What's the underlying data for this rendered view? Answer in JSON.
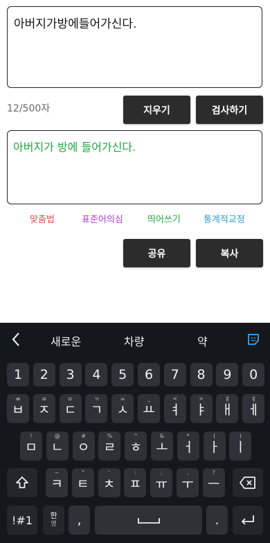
{
  "input": {
    "text": "아버지가방에들어가신다."
  },
  "counter": "12/500자",
  "buttons": {
    "clear": "지우기",
    "check": "검사하기",
    "share": "공유",
    "copy": "복사"
  },
  "output": {
    "text": "아버지가 방에 들어가신다."
  },
  "legend": [
    {
      "label": "맞춤법",
      "color": "#d9534f"
    },
    {
      "label": "표준어의심",
      "color": "#b03bd1"
    },
    {
      "label": "띄어쓰기",
      "color": "#1fa53f"
    },
    {
      "label": "통계적교정",
      "color": "#2aa0c8"
    }
  ],
  "keyboard": {
    "suggestions": [
      "새로운",
      "차량",
      "약"
    ],
    "numbers": [
      "1",
      "2",
      "3",
      "4",
      "5",
      "6",
      "7",
      "8",
      "9",
      "0"
    ],
    "row1": [
      {
        "k": "ㅂ",
        "h": "ㅃ"
      },
      {
        "k": "ㅈ",
        "h": "ㅉ"
      },
      {
        "k": "ㄷ",
        "h": "ㄸ"
      },
      {
        "k": "ㄱ",
        "h": "ㄲ"
      },
      {
        "k": "ㅅ",
        "h": "ㅆ"
      },
      {
        "k": "ㅛ",
        "h": "_"
      },
      {
        "k": "ㅕ",
        "h": "<"
      },
      {
        "k": "ㅑ",
        "h": ">"
      },
      {
        "k": "ㅐ",
        "h": "ㅒ"
      },
      {
        "k": "ㅔ",
        "h": "ㅖ"
      }
    ],
    "row2": [
      {
        "k": "ㅁ",
        "h": "!"
      },
      {
        "k": "ㄴ",
        "h": "@"
      },
      {
        "k": "ㅇ",
        "h": "#"
      },
      {
        "k": "ㄹ",
        "h": "%"
      },
      {
        "k": "ㅎ",
        "h": "^"
      },
      {
        "k": "ㅗ",
        "h": "&"
      },
      {
        "k": "ㅓ",
        "h": "*"
      },
      {
        "k": "ㅏ",
        "h": "("
      },
      {
        "k": "ㅣ",
        "h": ")"
      }
    ],
    "row3": [
      {
        "k": "ㅋ",
        "h": "~"
      },
      {
        "k": "ㅌ",
        "h": "\""
      },
      {
        "k": "ㅊ",
        "h": "'"
      },
      {
        "k": "ㅍ",
        "h": ":"
      },
      {
        "k": "ㅠ",
        "h": ";"
      },
      {
        "k": "ㅜ",
        "h": ","
      },
      {
        "k": "ㅡ",
        "h": "?"
      }
    ],
    "symbols_key": "!#1",
    "lang_key_top": "한",
    "lang_key_bottom": "영",
    "comma": ",",
    "period": ".",
    "shift_icon": "shift-icon",
    "backspace_icon": "backspace-icon",
    "space_icon": "space-icon",
    "enter_icon": "enter-icon",
    "back_icon": "chevron-left-icon",
    "sticker_icon": "sticker-icon"
  }
}
